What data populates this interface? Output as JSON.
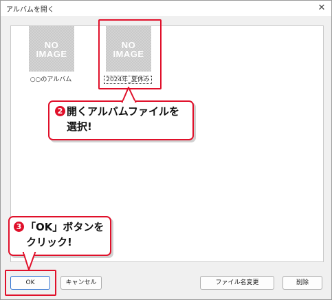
{
  "window": {
    "title": "アルバムを開く",
    "close_symbol": "✕"
  },
  "albums": [
    {
      "thumb_line1": "NO",
      "thumb_line2": "IMAGE",
      "label": "○○のアルバム",
      "selected": false
    },
    {
      "thumb_line1": "NO",
      "thumb_line2": "IMAGE",
      "label": "2024年_夏休み",
      "selected": true
    }
  ],
  "callouts": {
    "step2": {
      "number": "2",
      "line1": "開くアルバムファイルを",
      "line2": "選択!"
    },
    "step3": {
      "number": "3",
      "line1": "「OK」ボタンを",
      "line2": "クリック!"
    }
  },
  "buttons": {
    "ok": "OK",
    "cancel": "キャンセル",
    "rename": "ファイル名変更",
    "delete": "削除"
  },
  "colors": {
    "highlight": "#e0102a",
    "primary_border": "#2b6fd1"
  }
}
